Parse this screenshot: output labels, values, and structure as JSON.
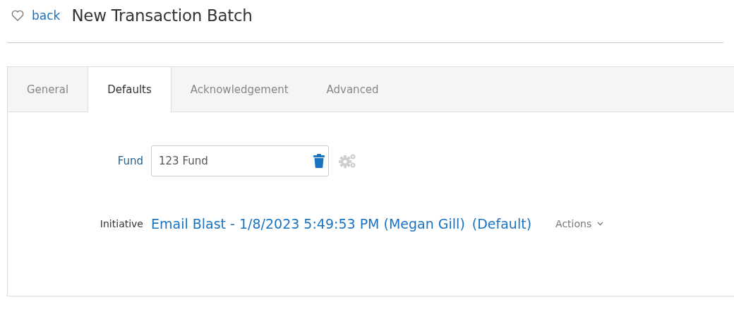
{
  "header": {
    "back": "back",
    "title": "New Transaction Batch"
  },
  "tabs": [
    {
      "label": "General",
      "selected": false
    },
    {
      "label": "Defaults",
      "selected": true
    },
    {
      "label": "Acknowledgement",
      "selected": false
    },
    {
      "label": "Advanced",
      "selected": false
    }
  ],
  "fund": {
    "label": "Fund",
    "value": "123 Fund"
  },
  "initiative": {
    "label": "Initiative",
    "link": "Email Blast - 1/8/2023 5:49:53 PM (Megan Gill)",
    "default": "(Default)",
    "actions": "Actions"
  }
}
